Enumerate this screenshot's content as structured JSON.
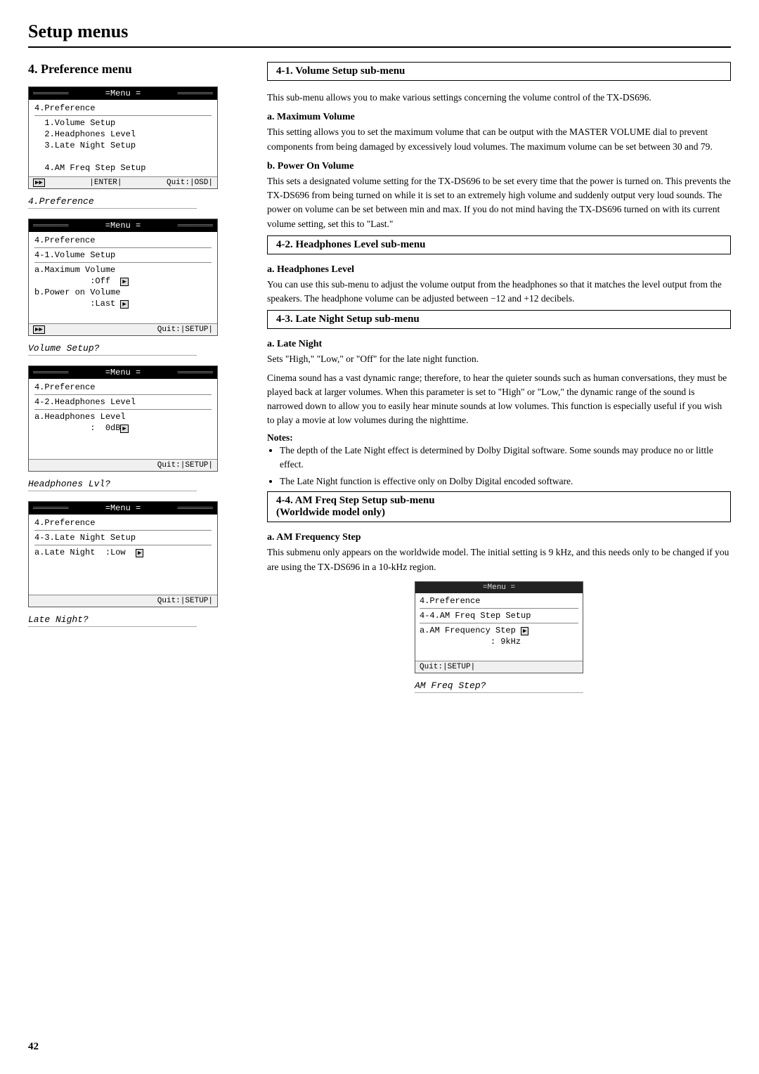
{
  "page": {
    "title": "Setup menus",
    "page_number": "42"
  },
  "left_col": {
    "section_title": "4. Preference menu",
    "menu_boxes": [
      {
        "id": "menu1",
        "title": "=Menu =",
        "lines": [
          "4.Preference",
          "---",
          "  1.Volume Setup",
          "  2.Headphones Level",
          "  3.Late Night Setup",
          "",
          "  4.AM Freq Step Setup"
        ],
        "bottom": [
          "[▶▶]",
          "|ENTER|",
          "Quit:|OSD|"
        ],
        "italic_label": "4.Preference"
      },
      {
        "id": "menu2",
        "title": "=Menu =",
        "lines": [
          "4.Preference",
          "---",
          "4-1.Volume Setup",
          "---",
          "a.Maximum Volume",
          "           :Off  [▶]",
          "b.Power on Volume",
          "           :Last [▶]"
        ],
        "bottom": [
          "[▶▶]",
          "",
          "Quit:|SETUP|"
        ],
        "italic_label": "Volume Setup?"
      },
      {
        "id": "menu3",
        "title": "=Menu =",
        "lines": [
          "4.Preference",
          "---",
          "4-2.Headphones Level",
          "---",
          "a.Headphones Level",
          "           :  0dB[▶]"
        ],
        "bottom": [
          "",
          "",
          "Quit:|SETUP|"
        ],
        "italic_label": "Headphones Lvl?"
      },
      {
        "id": "menu4",
        "title": "=Menu =",
        "lines": [
          "4.Preference",
          "---",
          "4-3.Late Night Setup",
          "---",
          "a.Late Night  :Low  [▶]"
        ],
        "bottom": [
          "",
          "",
          "Quit:|SETUP|"
        ],
        "italic_label": "Late Night?"
      }
    ]
  },
  "right_col": {
    "sections": [
      {
        "id": "sec1",
        "heading": "4-1.  Volume Setup sub-menu",
        "intro": "This sub-menu allows you to make various settings concerning the volume control of the TX-DS696.",
        "sub_sections": [
          {
            "label": "a. Maximum Volume",
            "text": "This setting allows you to set the maximum volume that can be output with the MASTER VOLUME dial to prevent components from being damaged by excessively loud volumes. The maximum volume can be set between 30 and 79."
          },
          {
            "label": "b. Power On Volume",
            "text": "This sets a designated volume setting for the TX-DS696 to be set every time that the power is turned on. This prevents the TX-DS696 from being turned on while it is set to an extremely high volume and suddenly output very loud sounds. The power on volume can be set between min and max. If you do not mind having the TX-DS696 turned on with its current volume setting, set this to \"Last.\""
          }
        ]
      },
      {
        "id": "sec2",
        "heading": "4-2.  Headphones Level sub-menu",
        "sub_sections": [
          {
            "label": "a.  Headphones Level",
            "text": "You can use this sub-menu to adjust the volume output from the headphones so that it matches the level output from the speakers. The headphone volume can be adjusted between −12 and +12 decibels."
          }
        ]
      },
      {
        "id": "sec3",
        "heading": "4-3.  Late Night Setup sub-menu",
        "sub_sections": [
          {
            "label": "a.  Late Night",
            "short_text": "Sets \"High,\" \"Low,\" or \"Off\" for the late night function.",
            "text": "Cinema sound has a vast dynamic range; therefore, to hear the quieter sounds such as human conversations, they must be played back at larger volumes. When this parameter is set to \"High\" or \"Low,\" the dynamic range of the sound is narrowed down to allow you to easily hear minute sounds at low volumes. This function is especially useful if you wish to play a movie at low volumes during the nighttime.",
            "notes_label": "Notes:",
            "bullets": [
              "The depth of the Late Night effect is determined by Dolby Digital software. Some sounds may produce no or little effect.",
              "The Late Night function is effective only on Dolby Digital encoded software."
            ]
          }
        ]
      },
      {
        "id": "sec4",
        "heading": "4-4.  AM Freq Step Setup sub-menu",
        "heading2": "(Worldwide model only)",
        "sub_sections": [
          {
            "label": "a.  AM Frequency Step",
            "text": "This submenu only appears on the worldwide model. The initial setting is 9 kHz, and this needs only to be changed if you are using the TX-DS696 in a 10-kHz region."
          }
        ],
        "bottom_menu": {
          "title": "=Menu =",
          "lines": [
            "4.Preference",
            "---",
            "4-4.AM Freq Step Setup",
            "---",
            "a.AM Frequency Step [▶]",
            "              : 9kHz"
          ],
          "bottom": "Quit:|SETUP|",
          "italic_label": "AM Freq Step?"
        }
      }
    ]
  }
}
